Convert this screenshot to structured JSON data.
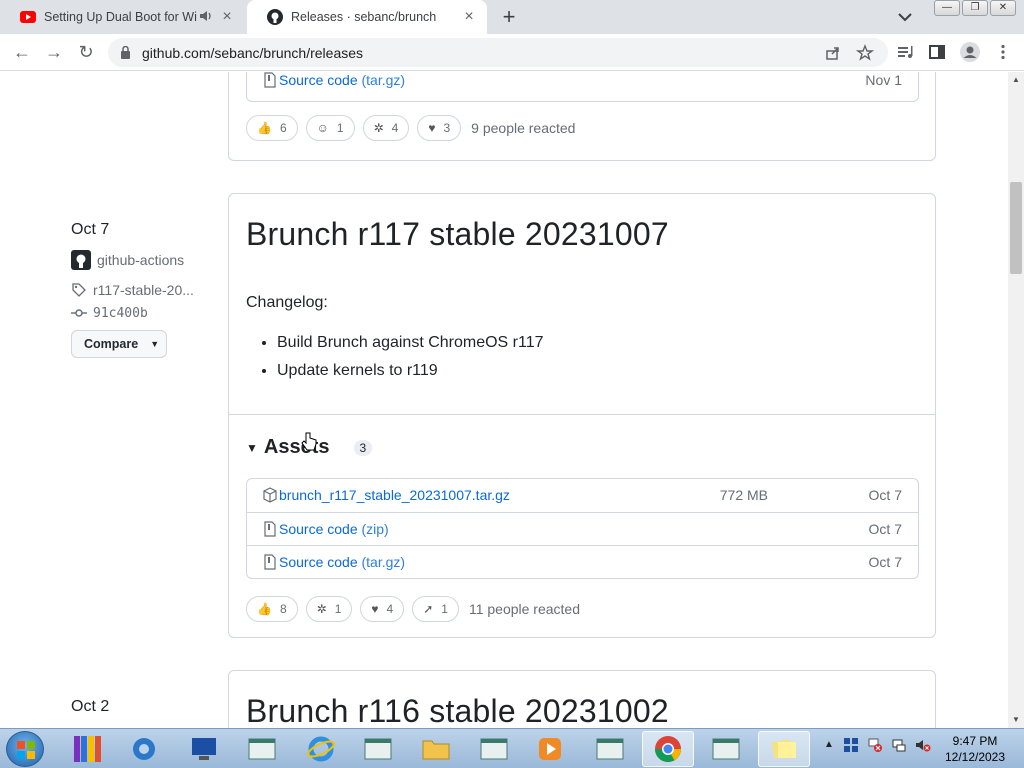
{
  "browser": {
    "tabs": [
      {
        "title": "Setting Up Dual Boot for Wi",
        "favicon": "youtube-icon",
        "audio": true
      },
      {
        "title": "Releases · sebanc/brunch",
        "favicon": "github-icon",
        "active": true
      }
    ],
    "url": "github.com/sebanc/brunch/releases"
  },
  "previous_release": {
    "asset": {
      "name": "Source code",
      "ext": "(tar.gz)",
      "date": "Nov 1"
    },
    "reactions": [
      {
        "icon": "thumbs-up",
        "count": "6"
      },
      {
        "icon": "laugh",
        "count": "1"
      },
      {
        "icon": "hooray",
        "count": "4"
      },
      {
        "icon": "heart",
        "count": "3"
      }
    ],
    "summary": "9 people reacted"
  },
  "release": {
    "date": "Oct 7",
    "author": "github-actions",
    "tag": "r117-stable-20...",
    "commit": "91c400b",
    "compare_label": "Compare",
    "title": "Brunch r117 stable 20231007",
    "changelog_label": "Changelog:",
    "changes": [
      "Build Brunch against ChromeOS r117",
      "Update kernels to r119"
    ],
    "assets_label": "Assets",
    "assets_count": "3",
    "assets": [
      {
        "name": "brunch_r117_stable_20231007.tar.gz",
        "ext": "",
        "size": "772 MB",
        "date": "Oct 7",
        "icon": "package-icon"
      },
      {
        "name": "Source code",
        "ext": "(zip)",
        "size": "",
        "date": "Oct 7",
        "icon": "file-zip-icon"
      },
      {
        "name": "Source code",
        "ext": "(tar.gz)",
        "size": "",
        "date": "Oct 7",
        "icon": "file-zip-icon"
      }
    ],
    "reactions": [
      {
        "icon": "thumbs-up",
        "count": "8"
      },
      {
        "icon": "hooray",
        "count": "1"
      },
      {
        "icon": "heart",
        "count": "4"
      },
      {
        "icon": "rocket",
        "count": "1"
      }
    ],
    "summary": "11 people reacted"
  },
  "next_release": {
    "date": "Oct 2",
    "title": "Brunch r116 stable 20231002"
  },
  "taskbar": {
    "time": "9:47 PM",
    "date": "12/12/2023"
  }
}
